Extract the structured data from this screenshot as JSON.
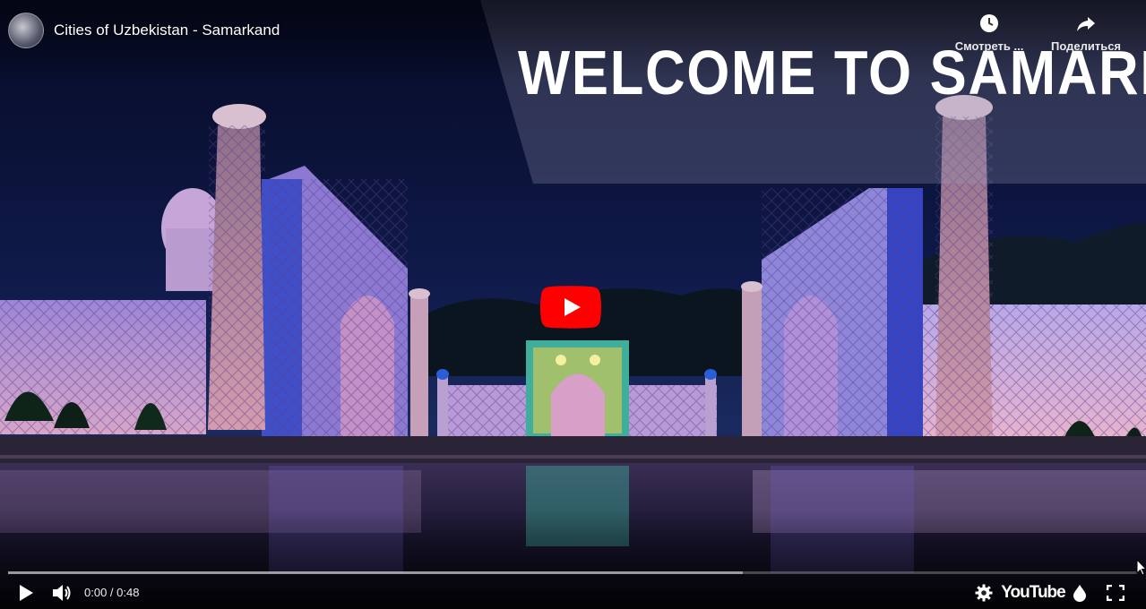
{
  "video": {
    "title": "Cities of Uzbekistan - Samarkand",
    "overlay_text": "WELCOME TO SAMARKAND"
  },
  "top_actions": {
    "watch_later_label": "Смотреть ...",
    "share_label": "Поделиться"
  },
  "player": {
    "time_display": "0:00 / 0:48",
    "progress_played": 0.0,
    "progress_loaded": 0.65,
    "brand_label": "YouTube"
  },
  "icons": {
    "avatar": "channel-avatar",
    "watch_later": "clock-icon",
    "share": "share-arrow-icon",
    "big_play": "youtube-play-button-icon",
    "play": "play-icon",
    "volume": "volume-icon",
    "settings": "gear-icon",
    "energy": "droplet-icon",
    "fullscreen": "fullscreen-icon"
  },
  "colors": {
    "play_button": "#ff0000",
    "progress": "#ff0000",
    "sky": "#0b1130"
  }
}
